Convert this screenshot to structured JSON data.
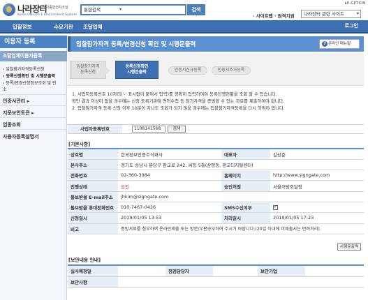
{
  "header": {
    "logo_title": "나라장터",
    "logo_sub1": "국가종합전자조달",
    "logo_sub2": "Korea ON-Line E-Procurement System",
    "search_category": "통합검색",
    "search_button": "검색",
    "sitemap": "· 사이트맵 · 원격지원",
    "related_sites": "나라장터 관련 사이트",
    "english_link": "▸E-GPTION"
  },
  "nav": {
    "items": [
      "입찰정보",
      "수요기관",
      "조달업체"
    ],
    "login": "로그인"
  },
  "sidebar": {
    "title": "이용자 등록",
    "active": "조달업체이용자등록",
    "subs": [
      "입찰참가자격등록신청",
      "등록신청확인 및 시행문출력",
      "등록/변경신청정보조회 및 인",
      "소"
    ],
    "menus": [
      "인증서관리",
      "지문보안토큰",
      "업종조회",
      "사용자등록설명서"
    ]
  },
  "main": {
    "title": "입찰참가자격 등록/변경신청 확인 및 시행문출력",
    "help_button": "온라인 매뉴얼",
    "steps": [
      "입찰참가자격\n등록신청",
      "등록신청확인\n시행문출력",
      "인증서신규등록",
      "인증서추가등록"
    ]
  },
  "notes": [
    "1.  사업자등록번호 10자리('-' 표시없이 붙여서 입력)를 정확히 입력하여야 등록진행현황을 조회 할 수 있습니다.",
    "     확인 결과 이상이 없을 경우에는 신청 등록기관에 면허수첩 등 참가자격을 증빙할 수 있는 자료를 제출하여야 합니다.",
    "2.  입찰참가자격 등록 신청 이후 10분이 지나도 조회가 되지 않을 경우에는 입찰참가자격등록을 다시 하여야 합니다."
  ],
  "biz_lookup": {
    "label": "사업자등록번호",
    "value": "1108141568",
    "button": "검색"
  },
  "basic": {
    "section": "[기본사항]",
    "rows": [
      {
        "l1": "상호명",
        "v1": "한국정보인증주식회사",
        "l2": "대표자",
        "v2": "김상준"
      },
      {
        "l1": "본사주소",
        "v1": "경기도 성남시 분당구 판교로 242, 씨동 5층(삼평동, 판교디지털센터)",
        "l2": "",
        "v2": ""
      },
      {
        "l1": "전화번호",
        "v1": "02-360-3084",
        "l2": "홈페이지",
        "v2": "http://www.signgate.com"
      },
      {
        "l1": "진행상태",
        "v1": "승인",
        "l2": "승인처정",
        "v2": "서울지방조달청"
      },
      {
        "l1": "통보받을 E-mail주소",
        "v1": "jhkim@signgate.com",
        "l2": "",
        "v2": ""
      },
      {
        "l1": "통보받을 휴대전화번호",
        "v1": "010-7467-0426",
        "l2": "SMS수신여부",
        "v2": ""
      },
      {
        "l1": "신청일시",
        "v1": "2019/01/05 13:53",
        "l2": "처리일시",
        "v2": "2019/01/05 17:23"
      },
      {
        "l1": "비고",
        "v1": "증빙서류를 첨부하여 온라인제출 또는 방문/우편송부하여 주시기 바랍니다.(20일 이내에 미제출시는 반려처리).",
        "l2": "",
        "v2": ""
      }
    ]
  },
  "print_button": "시행문출력",
  "security": {
    "section": "[보안내용 안내]",
    "labels": [
      "실사예정일",
      "점검담당자",
      "보안기업",
      "보안사항"
    ]
  }
}
